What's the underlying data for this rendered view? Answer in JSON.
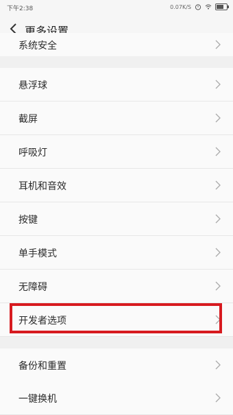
{
  "status_bar": {
    "time": "下午2:38",
    "speed": "0.07K/S"
  },
  "header": {
    "title": "更多设置"
  },
  "settings": [
    {
      "label": "系统安全"
    },
    {
      "label": "悬浮球"
    },
    {
      "label": "截屏"
    },
    {
      "label": "呼吸灯"
    },
    {
      "label": "耳机和音效"
    },
    {
      "label": "按键"
    },
    {
      "label": "单手模式"
    },
    {
      "label": "无障碍"
    },
    {
      "label": "开发者选项"
    },
    {
      "label": "备份和重置"
    },
    {
      "label": "一键换机"
    }
  ],
  "colors": {
    "highlight": "#d71a1f"
  },
  "icons": {
    "back": "chevron-left-icon",
    "row": "chevron-right-icon"
  }
}
